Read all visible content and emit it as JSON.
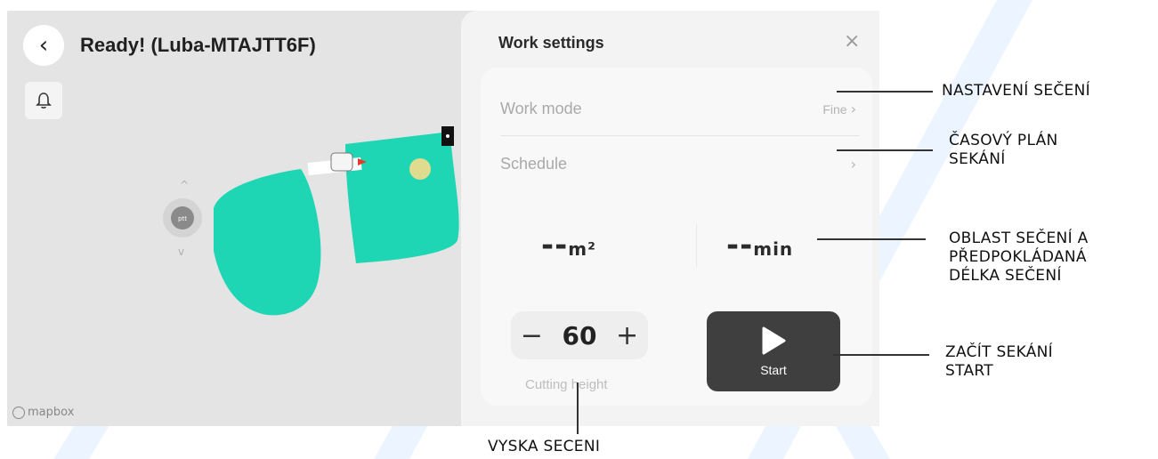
{
  "app": {
    "status_title": "Ready! (Luba-MTAJTT6F)",
    "back_icon": "chevron-left-icon",
    "bell_icon": "bell-icon",
    "map_attribution": "mapbox"
  },
  "map": {
    "zone_color": "#1fd6b4",
    "marker_color": "#e0dc8f",
    "joystick_label": "ptt"
  },
  "panel": {
    "title": "Work settings",
    "close_symbol": "×",
    "rows": [
      {
        "label": "Work mode",
        "value": "Fine",
        "chevron": "›"
      },
      {
        "label": "Schedule",
        "value": "",
        "chevron": "›"
      }
    ],
    "area_value": "--",
    "area_unit": "m²",
    "time_value": "--",
    "time_unit": "min",
    "cutting_height": {
      "minus": "−",
      "value": "60",
      "plus": "+",
      "label": "Cutting height"
    },
    "start_label": "Start"
  },
  "annotations": {
    "work_mode": "NASTAVENÍ SEČENÍ",
    "schedule": "ČASOVÝ PLÁN\nSEKÁNÍ",
    "area_time": "OBLAST SEČENÍ A\nPŘEDPOKLÁDANÁ\nDÉLKA SEČENÍ",
    "start": "ZAČÍT SEKÁNÍ\nSTART",
    "cutting_height": "VYSKA SECENI"
  },
  "watermark_color": "#cfe6ff"
}
